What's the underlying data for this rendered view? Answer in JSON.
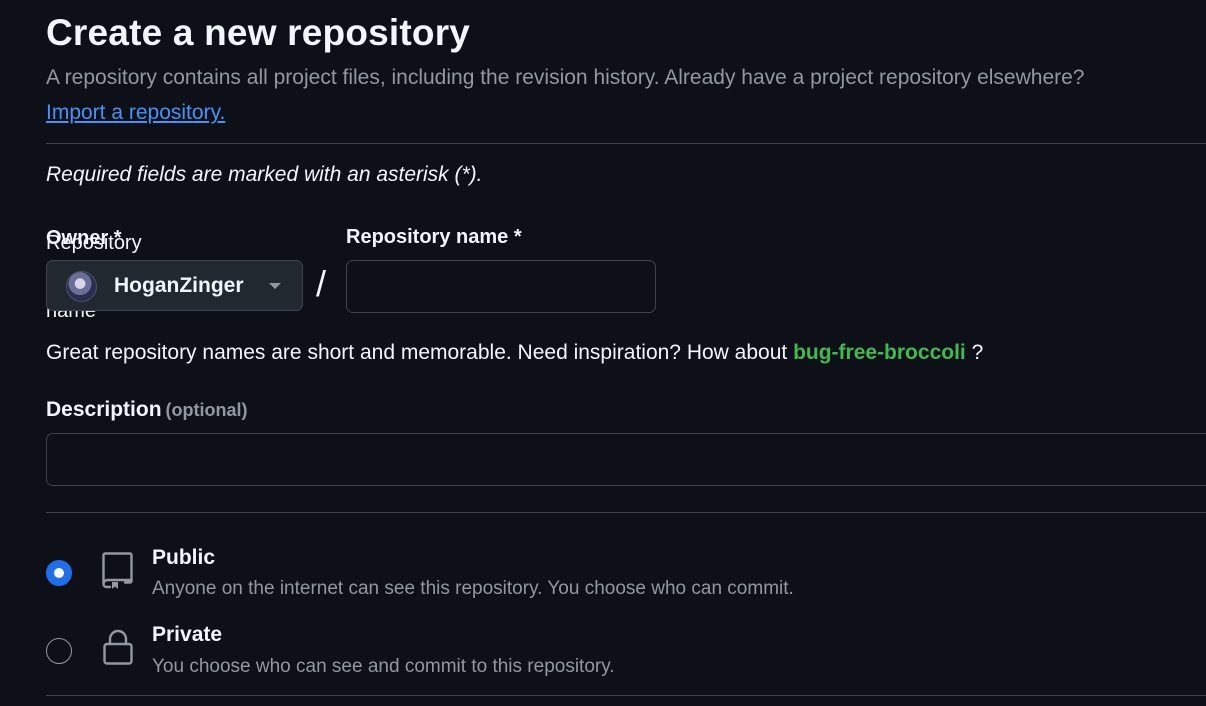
{
  "page": {
    "title": "Create a new repository",
    "subtitle": "A repository contains all project files, including the revision history. Already have a project repository elsewhere?",
    "import_link": "Import a repository.",
    "required_note": "Required fields are marked with an asterisk (*)."
  },
  "owner": {
    "label": "Owner *",
    "aria_label": "Repository owner and name",
    "selected": "HoganZinger"
  },
  "separator": "/",
  "repo_name": {
    "label": "Repository name *",
    "value": "",
    "placeholder": ""
  },
  "inspiration": {
    "text": "Great repository names are short and memorable. Need inspiration? How about",
    "suggestion": "bug-free-broccoli",
    "suffix": "?"
  },
  "description": {
    "label": "Description",
    "optional": "(optional)",
    "value": "",
    "placeholder": ""
  },
  "visibility": {
    "selected": "public",
    "options": [
      {
        "id": "public",
        "title": "Public",
        "description": "Anyone on the internet can see this repository. You choose who can commit.",
        "icon": "repo-icon"
      },
      {
        "id": "private",
        "title": "Private",
        "description": "You choose who can see and commit to this repository.",
        "icon": "lock-icon"
      }
    ]
  },
  "colors": {
    "background": "#0d1117",
    "link": "#4493f8",
    "suggestion": "#3fb950",
    "radio_selected": "#1f6feb",
    "border": "#3d444d",
    "muted": "#9198a1"
  }
}
